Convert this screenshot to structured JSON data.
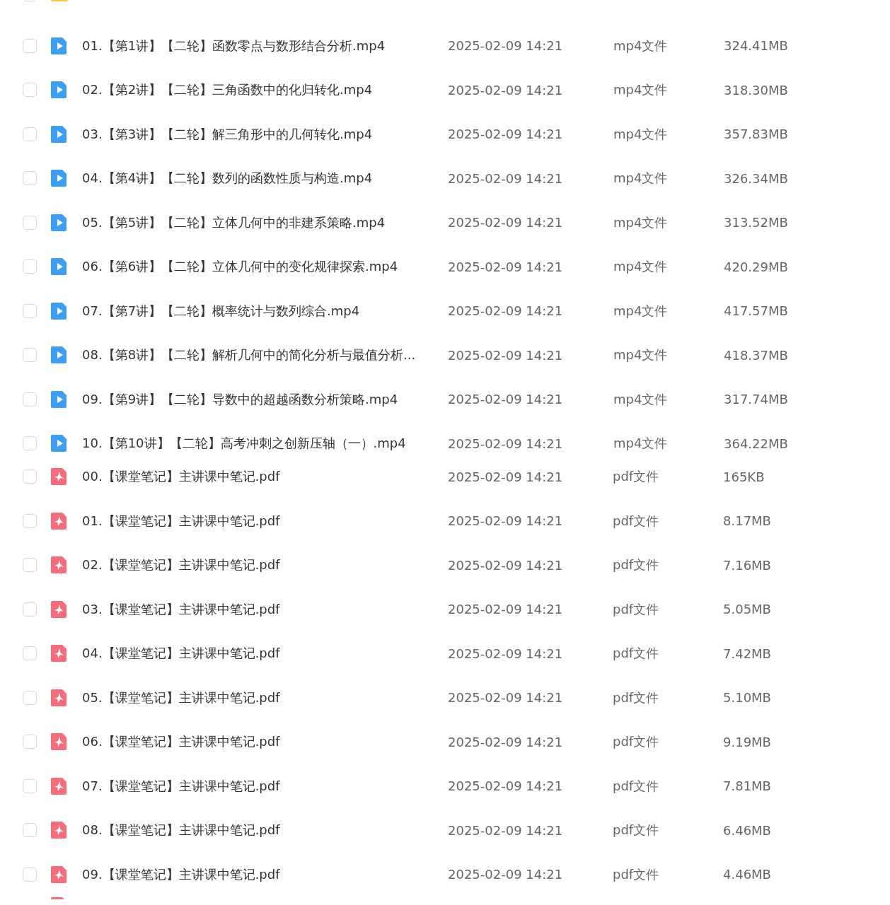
{
  "top_partial_row": {
    "kind": "folder",
    "checked": false
  },
  "files": [
    {
      "kind": "video",
      "checked": false,
      "name": "01.【第1讲】【二轮】函数零点与数形结合分析.mp4",
      "date": "2025-02-09 14:21",
      "type": "mp4文件",
      "size": "324.41MB"
    },
    {
      "kind": "video",
      "checked": false,
      "name": "02.【第2讲】【二轮】三角函数中的化归转化.mp4",
      "date": "2025-02-09 14:21",
      "type": "mp4文件",
      "size": "318.30MB"
    },
    {
      "kind": "video",
      "checked": false,
      "name": "03.【第3讲】【二轮】解三角形中的几何转化.mp4",
      "date": "2025-02-09 14:21",
      "type": "mp4文件",
      "size": "357.83MB"
    },
    {
      "kind": "video",
      "checked": false,
      "name": "04.【第4讲】【二轮】数列的函数性质与构造.mp4",
      "date": "2025-02-09 14:21",
      "type": "mp4文件",
      "size": "326.34MB"
    },
    {
      "kind": "video",
      "checked": false,
      "name": "05.【第5讲】【二轮】立体几何中的非建系策略.mp4",
      "date": "2025-02-09 14:21",
      "type": "mp4文件",
      "size": "313.52MB"
    },
    {
      "kind": "video",
      "checked": false,
      "name": "06.【第6讲】【二轮】立体几何中的变化规律探索.mp4",
      "date": "2025-02-09 14:21",
      "type": "mp4文件",
      "size": "420.29MB"
    },
    {
      "kind": "video",
      "checked": false,
      "name": "07.【第7讲】【二轮】概率统计与数列综合.mp4",
      "date": "2025-02-09 14:21",
      "type": "mp4文件",
      "size": "417.57MB"
    },
    {
      "kind": "video",
      "checked": false,
      "name": "08.【第8讲】【二轮】解析几何中的简化分析与最值分析...",
      "date": "2025-02-09 14:21",
      "type": "mp4文件",
      "size": "418.37MB"
    },
    {
      "kind": "video",
      "checked": false,
      "name": "09.【第9讲】【二轮】导数中的超越函数分析策略.mp4",
      "date": "2025-02-09 14:21",
      "type": "mp4文件",
      "size": "317.74MB"
    },
    {
      "kind": "video",
      "checked": false,
      "name": "10.【第10讲】【二轮】高考冲刺之创新压轴（一）.mp4",
      "date": "2025-02-09 14:21",
      "type": "mp4文件",
      "size": "364.22MB"
    },
    {
      "kind": "pdf",
      "checked": false,
      "name": "00.【课堂笔记】主讲课中笔记.pdf",
      "date": "2025-02-09 14:21",
      "type": "pdf文件",
      "size": "165KB"
    },
    {
      "kind": "pdf",
      "checked": false,
      "name": "01.【课堂笔记】主讲课中笔记.pdf",
      "date": "2025-02-09 14:21",
      "type": "pdf文件",
      "size": "8.17MB"
    },
    {
      "kind": "pdf",
      "checked": false,
      "name": "02.【课堂笔记】主讲课中笔记.pdf",
      "date": "2025-02-09 14:21",
      "type": "pdf文件",
      "size": "7.16MB"
    },
    {
      "kind": "pdf",
      "checked": false,
      "name": "03.【课堂笔记】主讲课中笔记.pdf",
      "date": "2025-02-09 14:21",
      "type": "pdf文件",
      "size": "5.05MB"
    },
    {
      "kind": "pdf",
      "checked": false,
      "name": "04.【课堂笔记】主讲课中笔记.pdf",
      "date": "2025-02-09 14:21",
      "type": "pdf文件",
      "size": "7.42MB"
    },
    {
      "kind": "pdf",
      "checked": false,
      "name": "05.【课堂笔记】主讲课中笔记.pdf",
      "date": "2025-02-09 14:21",
      "type": "pdf文件",
      "size": "5.10MB"
    },
    {
      "kind": "pdf",
      "checked": false,
      "name": "06.【课堂笔记】主讲课中笔记.pdf",
      "date": "2025-02-09 14:21",
      "type": "pdf文件",
      "size": "9.19MB"
    },
    {
      "kind": "pdf",
      "checked": false,
      "name": "07.【课堂笔记】主讲课中笔记.pdf",
      "date": "2025-02-09 14:21",
      "type": "pdf文件",
      "size": "7.81MB"
    },
    {
      "kind": "pdf",
      "checked": false,
      "name": "08.【课堂笔记】主讲课中笔记.pdf",
      "date": "2025-02-09 14:21",
      "type": "pdf文件",
      "size": "6.46MB"
    },
    {
      "kind": "pdf",
      "checked": false,
      "name": "09.【课堂笔记】主讲课中笔记.pdf",
      "date": "2025-02-09 14:21",
      "type": "pdf文件",
      "size": "4.46MB"
    }
  ],
  "bottom_partial_row": {
    "kind": "pdf"
  }
}
